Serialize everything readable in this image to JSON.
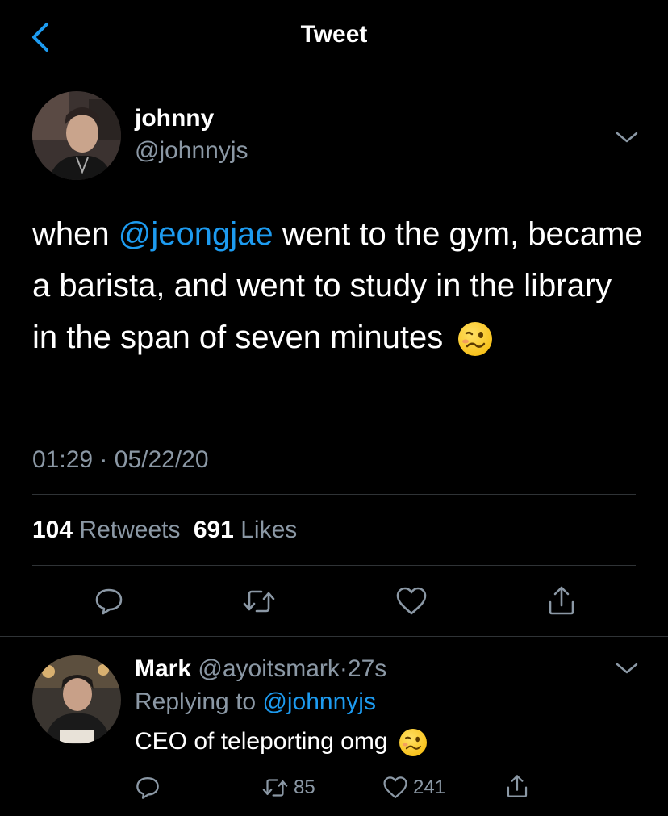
{
  "header": {
    "title": "Tweet"
  },
  "tweet": {
    "display_name": "johnny",
    "handle": "@johnnyjs",
    "text_before": "when ",
    "mention": "@jeongjae",
    "text_after": " went to the gym, became a barista, and went to study in the library in the span of seven minutes",
    "emoji": "woozy-face",
    "time": "01:29",
    "separator": "·",
    "date": "05/22/20",
    "retweets_count": "104",
    "retweets_label": "Retweets",
    "likes_count": "691",
    "likes_label": "Likes"
  },
  "reply": {
    "display_name": "Mark",
    "handle": "@ayoitsmark",
    "separator": "·",
    "age": "27s",
    "replying_prefix": "Replying to",
    "replying_to": "@johnnyjs",
    "text": "CEO of teleporting omg",
    "emoji": "woozy-face",
    "retweet_count": "85",
    "like_count": "241"
  },
  "colors": {
    "accent": "#1d9bf0",
    "muted": "#8b98a5",
    "divider": "#2f3336"
  }
}
